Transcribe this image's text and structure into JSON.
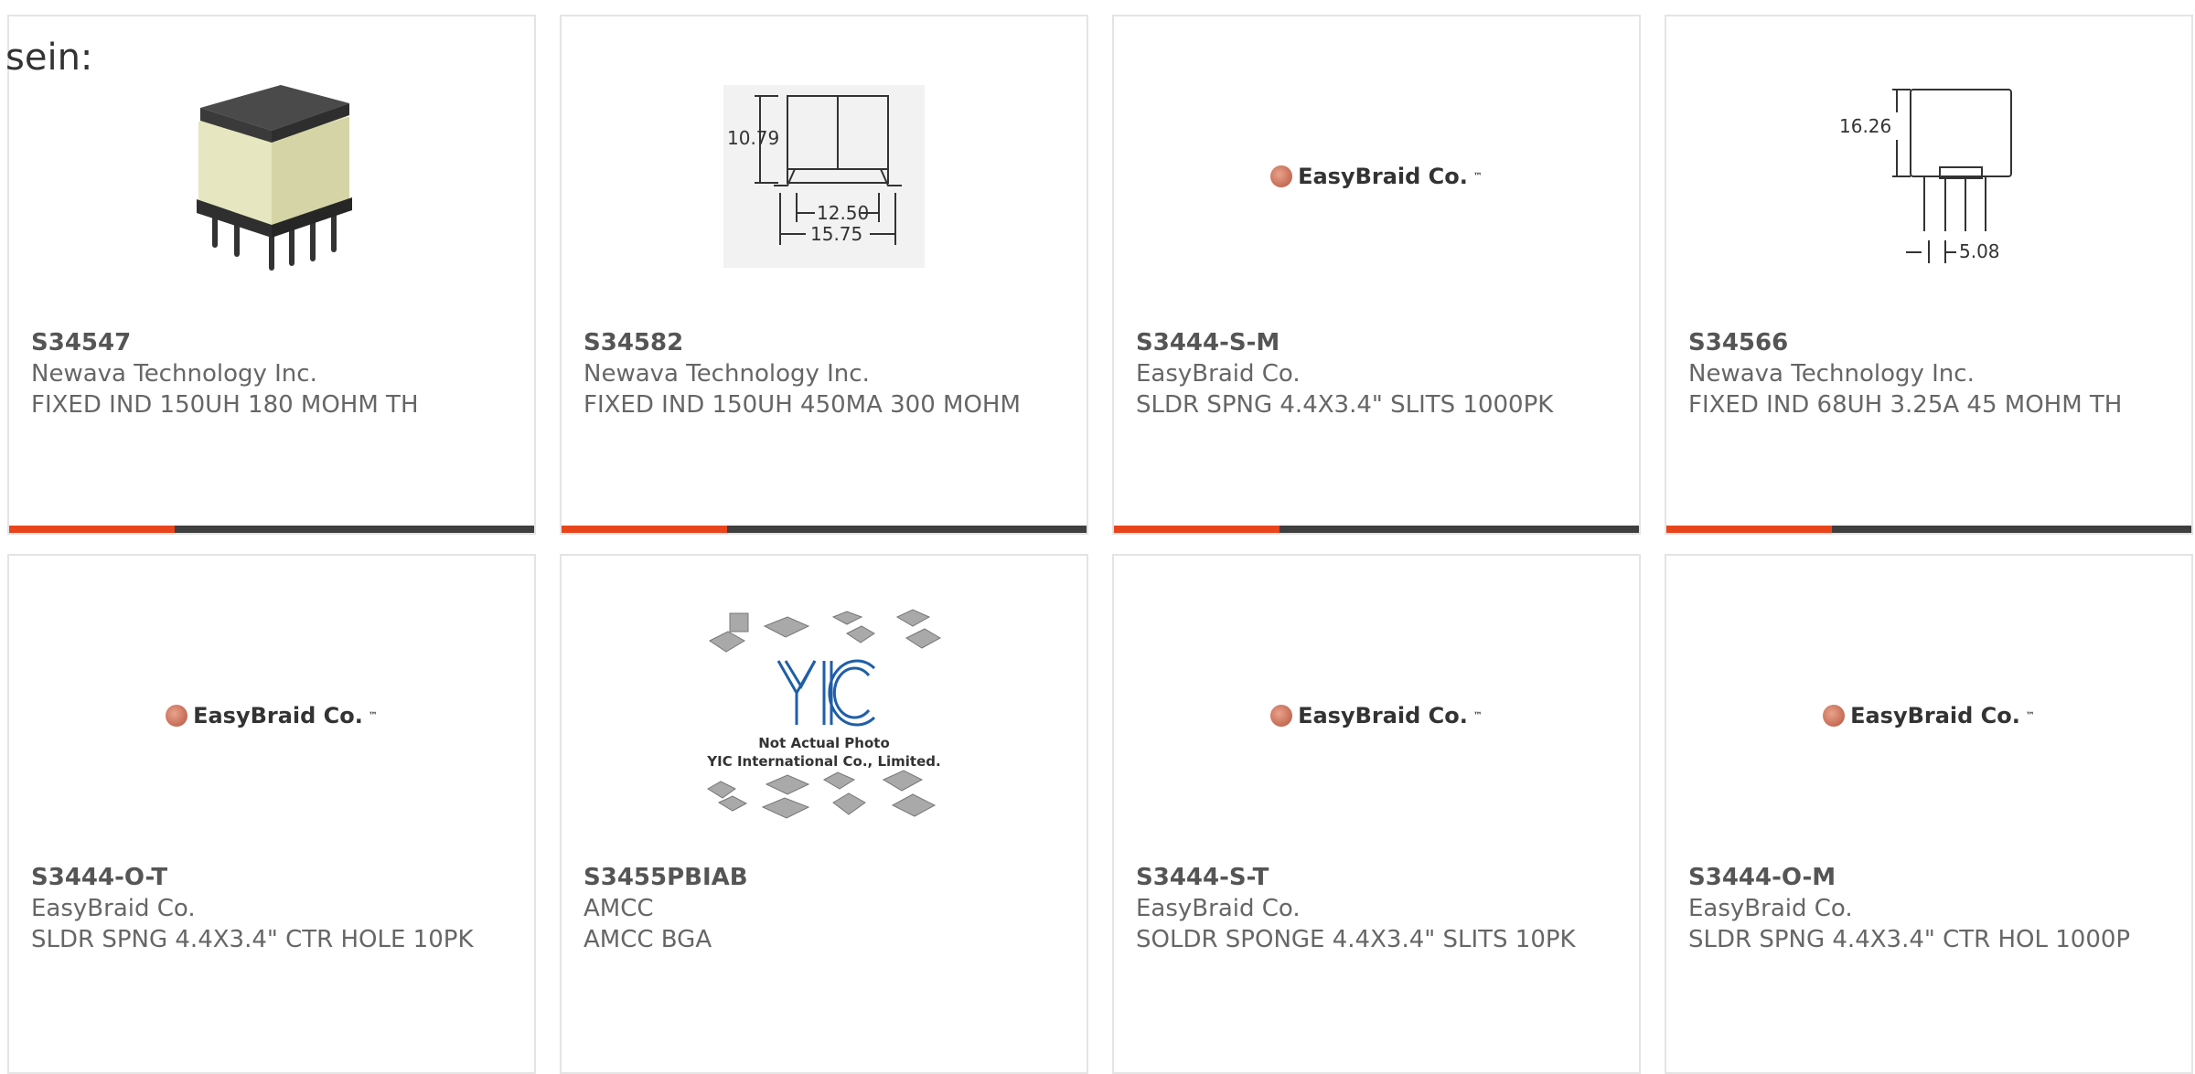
{
  "prefix_text": "sein:",
  "colors": {
    "accent": "#e8451c",
    "bar": "#3f3f3f",
    "border": "#e4e4e4"
  },
  "products": [
    {
      "part": "S34547",
      "manufacturer": "Newava Technology Inc.",
      "description": "FIXED IND 150UH 180 MOHM TH",
      "image": "inductor-photo",
      "has_bar": true
    },
    {
      "part": "S34582",
      "manufacturer": "Newava Technology Inc.",
      "description": "FIXED IND 150UH 450MA 300 MOHM",
      "image": "dimension-drawing-smd",
      "dims": [
        "10.79",
        "12.50",
        "15.75"
      ],
      "has_bar": true
    },
    {
      "part": "S3444-S-M",
      "manufacturer": "EasyBraid Co.",
      "description": "SLDR SPNG 4.4X3.4\" SLITS 1000PK",
      "image": "easybraid-logo",
      "logo_text": "EasyBraid Co.",
      "has_bar": true
    },
    {
      "part": "S34566",
      "manufacturer": "Newava Technology Inc.",
      "description": "FIXED IND 68UH 3.25A 45 MOHM TH",
      "image": "dimension-drawing-th",
      "dims": [
        "16.26",
        "5.08"
      ],
      "has_bar": true
    },
    {
      "part": "S3444-O-T",
      "manufacturer": "EasyBraid Co.",
      "description": "SLDR SPNG 4.4X3.4\" CTR HOLE 10PK",
      "image": "easybraid-logo",
      "logo_text": "EasyBraid Co.",
      "has_bar": false
    },
    {
      "part": "S3455PBIAB",
      "manufacturer": "AMCC",
      "description": "AMCC BGA",
      "image": "yic-placeholder",
      "caption_lines": [
        "Not Actual Photo",
        "YIC International Co., Limited."
      ],
      "has_bar": false
    },
    {
      "part": "S3444-S-T",
      "manufacturer": "EasyBraid Co.",
      "description": "SOLDR SPONGE 4.4X3.4\" SLITS 10PK",
      "image": "easybraid-logo",
      "logo_text": "EasyBraid Co.",
      "has_bar": false
    },
    {
      "part": "S3444-O-M",
      "manufacturer": "EasyBraid Co.",
      "description": "SLDR SPNG 4.4X3.4\" CTR HOL 1000P",
      "image": "easybraid-logo",
      "logo_text": "EasyBraid Co.",
      "has_bar": false
    }
  ]
}
